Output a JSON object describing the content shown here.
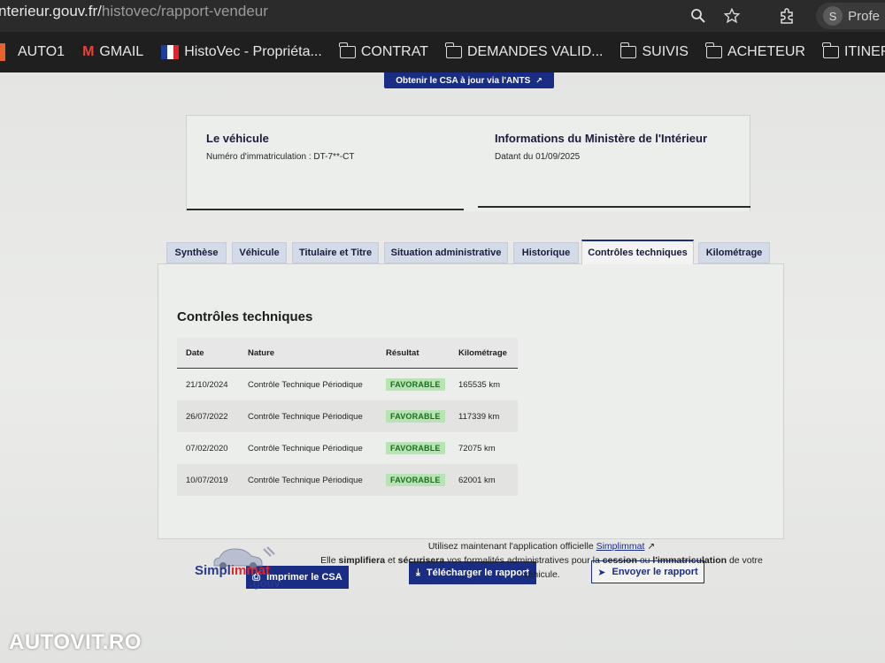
{
  "browser": {
    "url_host": "nterieur.gouv.fr/",
    "url_path": "histovec/rapport-vendeur",
    "profile_initial": "S",
    "profile_label": "Profe",
    "bookmarks": [
      {
        "label": "AUTO1",
        "icon": "orange-block-icon"
      },
      {
        "label": "GMAIL",
        "icon": "gmail-icon"
      },
      {
        "label": "HistoVec - Propriéta...",
        "icon": "french-flag-icon"
      },
      {
        "label": "CONTRAT",
        "icon": "folder-icon"
      },
      {
        "label": "DEMANDES VALID...",
        "icon": "folder-icon"
      },
      {
        "label": "SUIVIS",
        "icon": "folder-icon"
      },
      {
        "label": "ACHETEUR",
        "icon": "folder-icon"
      },
      {
        "label": "ITINERA",
        "icon": "folder-icon"
      }
    ]
  },
  "header": {
    "csa_button": "Obtenir le CSA à jour via l'ANTS"
  },
  "vehicle_info": {
    "title": "Le véhicule",
    "plate_text": "Numéro d'immatriculation : DT-7**-CT"
  },
  "ministry_info": {
    "title": "Informations du Ministère de l'Intérieur",
    "date_text": "Datant du 01/09/2025"
  },
  "tabs": [
    {
      "label": "Synthèse",
      "active": false
    },
    {
      "label": "Véhicule",
      "active": false
    },
    {
      "label": "Titulaire et Titre",
      "active": false
    },
    {
      "label": "Situation administrative",
      "active": false
    },
    {
      "label": "Historique",
      "active": false
    },
    {
      "label": "Contrôles techniques",
      "active": true
    },
    {
      "label": "Kilométrage",
      "active": false
    }
  ],
  "controls": {
    "title": "Contrôles techniques",
    "columns": [
      "Date",
      "Nature",
      "Résultat",
      "Kilométrage"
    ],
    "rows": [
      {
        "date": "21/10/2024",
        "nature": "Contrôle Technique Périodique",
        "result": "FAVORABLE",
        "km": "165535 km"
      },
      {
        "date": "26/07/2022",
        "nature": "Contrôle Technique Périodique",
        "result": "FAVORABLE",
        "km": "117339 km"
      },
      {
        "date": "07/02/2020",
        "nature": "Contrôle Technique Périodique",
        "result": "FAVORABLE",
        "km": "72075 km"
      },
      {
        "date": "10/07/2019",
        "nature": "Contrôle Technique Périodique",
        "result": "FAVORABLE",
        "km": "62001 km"
      }
    ]
  },
  "actions": {
    "print_label": "Imprimer le CSA",
    "download_label": "Télécharger le rapport",
    "send_label": "Envoyer le rapport"
  },
  "promo": {
    "line1_prefix": "Utilisez maintenant l'application officielle",
    "link": "Simplimmat",
    "line2_prefix": "Elle",
    "bold1": "simplifiera",
    "mid1": "et",
    "bold2": "sécurisera",
    "mid2": "vos formalités administratives pour la",
    "bold3": "cession",
    "mid3": "ou",
    "bold4": "l'immatriculation",
    "suffix": "de votre véhicule."
  },
  "logo": {
    "simpl": "Simpl",
    "immat": "immat",
    "gouv": ".gouv"
  },
  "watermark": "AUTOVIT.RO",
  "colors": {
    "primary": "#1a2d84",
    "favorable_bg": "#b8e4b3",
    "favorable_text": "#1c6b20"
  }
}
